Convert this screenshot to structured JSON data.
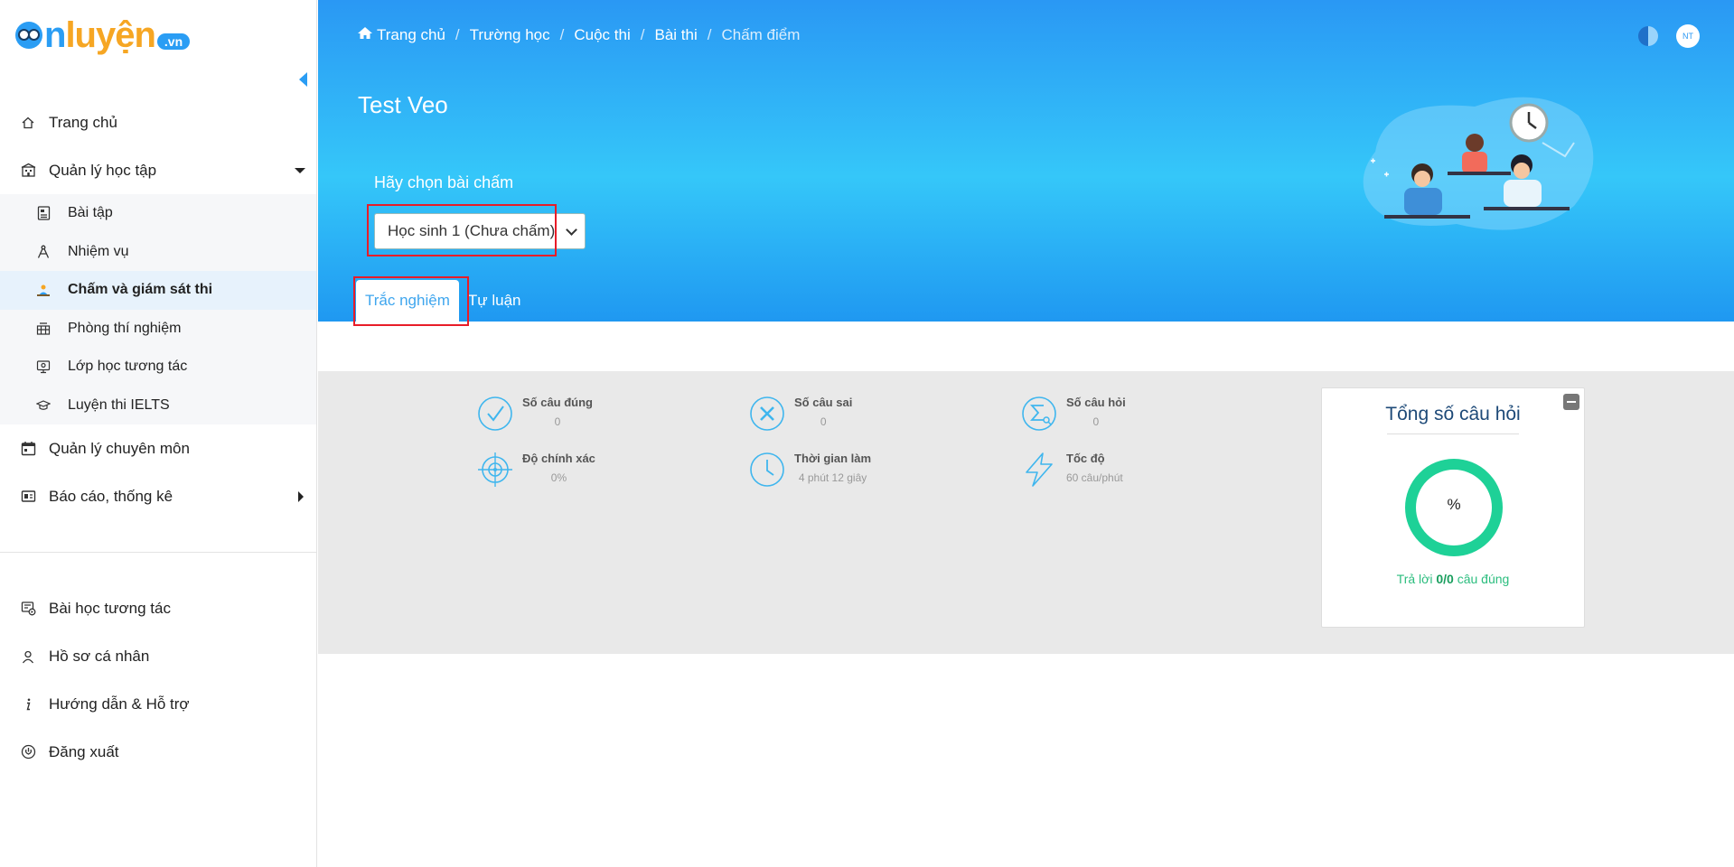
{
  "brand": {
    "part1": "n",
    "part2": "luyện",
    "domain": ".vn"
  },
  "sidebar": {
    "items": [
      {
        "label": "Trang chủ",
        "icon": "home-icon"
      },
      {
        "label": "Quản lý học tập",
        "icon": "school-icon",
        "expanded": true
      },
      {
        "label": "Quản lý chuyên môn",
        "icon": "calendar-icon"
      },
      {
        "label": "Báo cáo, thống kê",
        "icon": "report-icon"
      }
    ],
    "subitems": [
      {
        "label": "Bài tập",
        "icon": "exercise-icon"
      },
      {
        "label": "Nhiệm vụ",
        "icon": "compass-icon"
      },
      {
        "label": "Chấm và giám sát thi",
        "icon": "grading-icon",
        "active": true
      },
      {
        "label": "Phòng thí nghiệm",
        "icon": "lab-icon"
      },
      {
        "label": "Lớp học tương tác",
        "icon": "interactive-class-icon"
      },
      {
        "label": "Luyện thi IELTS",
        "icon": "ielts-icon"
      }
    ],
    "bottom": [
      {
        "label": "Bài học tương tác",
        "icon": "interactive-lesson-icon"
      },
      {
        "label": "Hồ sơ cá nhân",
        "icon": "user-icon"
      },
      {
        "label": "Hướng dẫn & Hỗ trợ",
        "icon": "info-icon"
      },
      {
        "label": "Đăng xuất",
        "icon": "power-icon"
      }
    ]
  },
  "breadcrumb": [
    "Trang chủ",
    "Trường học",
    "Cuộc thi",
    "Bài thi",
    "Chấm điểm"
  ],
  "header": {
    "title": "Test Veo",
    "choose_label": "Hãy chọn bài chấm",
    "selected_student": "Học sinh 1 (Chưa chấm)",
    "avatar_initials": "NT"
  },
  "tabs": [
    {
      "label": "Trắc nghiệm",
      "active": true
    },
    {
      "label": "Tự luận",
      "active": false
    }
  ],
  "stats": [
    {
      "label": "Số câu đúng",
      "value": "0",
      "icon": "check-circle-icon"
    },
    {
      "label": "Số câu sai",
      "value": "0",
      "icon": "x-circle-icon"
    },
    {
      "label": "Số câu hỏi",
      "value": "0",
      "icon": "sigma-icon"
    },
    {
      "label": "Độ chính xác",
      "value": "0%",
      "icon": "target-icon"
    },
    {
      "label": "Thời gian làm",
      "value": "4 phút 12 giây",
      "icon": "clock-icon"
    },
    {
      "label": "Tốc độ",
      "value": "60 câu/phút",
      "icon": "lightning-icon"
    }
  ],
  "summary": {
    "title": "Tổng số câu hỏi",
    "donut_label": "%",
    "answer_prefix": "Trả lời ",
    "answer_value": "0/0",
    "answer_suffix": " câu đúng",
    "ring_color": "#1ed197"
  },
  "colors": {
    "accent": "#2a98f4",
    "highlight_frame": "#e81c28",
    "tab_active_text": "#3fa6ee"
  }
}
